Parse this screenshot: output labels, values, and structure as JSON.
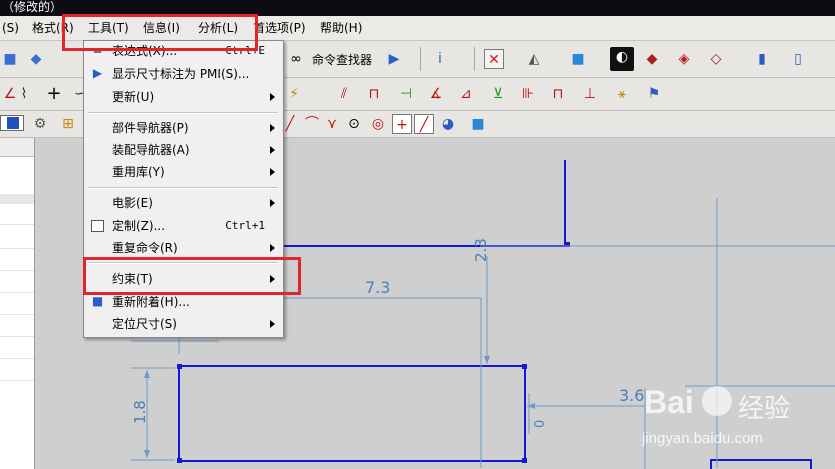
{
  "title_bar": {
    "text": "（修改的）"
  },
  "menubar": {
    "items": [
      {
        "label": "(S)"
      },
      {
        "label": "格式(R)"
      },
      {
        "label": "工具(T)"
      },
      {
        "label": "信息(I)"
      },
      {
        "label": "分析(L)"
      },
      {
        "label": "首选项(P)"
      },
      {
        "label": "帮助(H)"
      }
    ]
  },
  "toolbar": {
    "command_finder_label": "命令查找器"
  },
  "tools_menu": {
    "items": [
      {
        "label": "表达式(X)...",
        "shortcut": "Ctrl+E"
      },
      {
        "label": "显示尺寸标注为 PMI(S)..."
      },
      {
        "label": "更新(U)"
      },
      {
        "label": "部件导航器(P)"
      },
      {
        "label": "装配导航器(A)"
      },
      {
        "label": "重用库(Y)"
      },
      {
        "label": "电影(E)"
      },
      {
        "label": "定制(Z)...",
        "shortcut": "Ctrl+1"
      },
      {
        "label": "重复命令(R)"
      },
      {
        "label": "约束(T)"
      },
      {
        "label": "重新附着(H)..."
      },
      {
        "label": "定位尺寸(S)"
      }
    ]
  },
  "drawing": {
    "dims": [
      {
        "value": "7.3"
      },
      {
        "value": "2.3"
      },
      {
        "value": "1.8"
      },
      {
        "value": "3.6"
      },
      {
        "value": "0"
      }
    ]
  },
  "watermark": {
    "brand": "Bai",
    "brand_cn": "经验",
    "url": "jingyan.baidu.com"
  },
  "colors": {
    "sketch_line": "#1616d8",
    "dim_line": "#6d9bc8",
    "highlight": "#e0262d"
  }
}
